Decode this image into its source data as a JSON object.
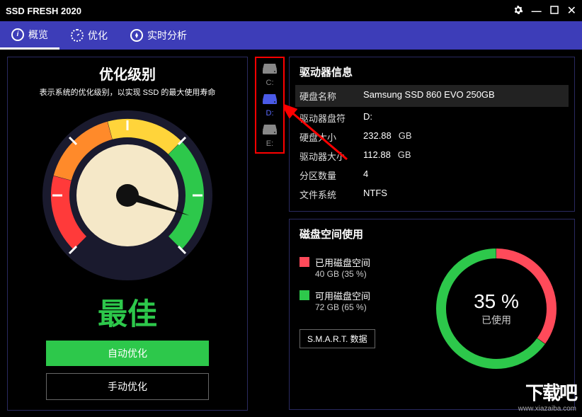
{
  "window": {
    "title": "SSD FRESH 2020"
  },
  "tabs": {
    "overview": "概览",
    "optimize": "优化",
    "realtime": "实时分析"
  },
  "optimization": {
    "title": "优化级别",
    "desc": "表示系统的优化级别，以实现 SSD 的最大使用寿命",
    "status": "最佳",
    "auto_btn": "自动优化",
    "manual_btn": "手动优化"
  },
  "drives": {
    "items": [
      {
        "label": "C:",
        "selected": false
      },
      {
        "label": "D:",
        "selected": true
      },
      {
        "label": "E:",
        "selected": false
      }
    ]
  },
  "drive_info": {
    "title": "驱动器信息",
    "rows": {
      "name_k": "硬盘名称",
      "name_v": "Samsung SSD 860 EVO 250GB",
      "letter_k": "驱动器盘符",
      "letter_v": "D:",
      "disk_size_k": "硬盘大小",
      "disk_size_v": "232.88",
      "disk_size_u": "GB",
      "drv_size_k": "驱动器大小",
      "drv_size_v": "112.88",
      "drv_size_u": "GB",
      "parts_k": "分区数量",
      "parts_v": "4",
      "fs_k": "文件系统",
      "fs_v": "NTFS"
    }
  },
  "disk_usage": {
    "title": "磁盘空间使用",
    "used_label": "已用磁盘空间",
    "used_detail": "40 GB (35 %)",
    "free_label": "可用磁盘空间",
    "free_detail": "72 GB (65 %)",
    "smart_btn": "S.M.A.R.T. 数据",
    "percent": "35 %",
    "percent_label": "已使用"
  },
  "watermark": {
    "text": "下载吧",
    "url": "www.xiazaiba.com"
  },
  "chart_data": [
    {
      "type": "gauge",
      "title": "优化级别",
      "value": 95,
      "range": [
        0,
        100
      ],
      "status": "最佳"
    },
    {
      "type": "pie",
      "title": "磁盘空间使用",
      "series": [
        {
          "name": "已用磁盘空间",
          "value": 40,
          "pct": 35,
          "color": "#ff4a5a"
        },
        {
          "name": "可用磁盘空间",
          "value": 72,
          "pct": 65,
          "color": "#2dc84b"
        }
      ],
      "unit": "GB",
      "center_label": "35 % 已使用"
    }
  ]
}
